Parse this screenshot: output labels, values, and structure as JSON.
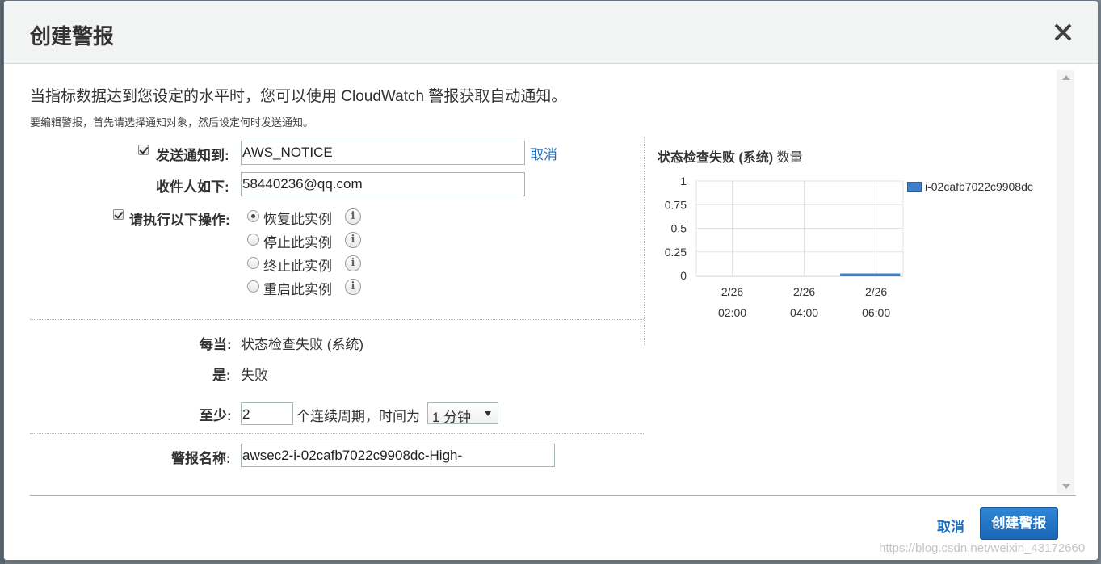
{
  "dialog": {
    "title": "创建警报",
    "intro_line1": "当指标数据达到您设定的水平时，您可以使用 CloudWatch 警报获取自动通知。",
    "intro_line2": "要编辑警报，首先请选择通知对象，然后设定何时发送通知。"
  },
  "form": {
    "send_notification": {
      "checked": true,
      "label": "发送通知到:",
      "value": "AWS_NOTICE",
      "cancel_link": "取消"
    },
    "recipients": {
      "label": "收件人如下:",
      "value": "58440236@qq.com"
    },
    "actions": {
      "checked": true,
      "label": "请执行以下操作:",
      "options": [
        {
          "label": "恢复此实例",
          "selected": true,
          "info_icon": "info-icon"
        },
        {
          "label": "停止此实例",
          "selected": false,
          "info_icon": "info-icon"
        },
        {
          "label": "终止此实例",
          "selected": false,
          "info_icon": "info-icon"
        },
        {
          "label": "重启此实例",
          "selected": false,
          "info_icon": "info-icon"
        }
      ]
    },
    "whenever": {
      "label": "每当:",
      "value": "状态检查失败 (系统)"
    },
    "is": {
      "label": "是:",
      "value": "失败"
    },
    "at_least": {
      "label": "至少:",
      "value": "2",
      "periods_text": "个连续周期，时间为",
      "period_select": "1 分钟"
    },
    "alarm_name": {
      "label": "警报名称:",
      "value": "awsec2-i-02cafb7022c9908dc-High-"
    }
  },
  "chart": {
    "title_bold": "状态检查失败 (系统)",
    "title_rest": " 数量"
  },
  "chart_data": {
    "type": "line",
    "title": "状态检查失败 (系统) 数量",
    "xlabel": "",
    "ylabel": "",
    "ylim": [
      0,
      1
    ],
    "yticks": [
      "1",
      "0.75",
      "0.5",
      "0.25",
      "0"
    ],
    "xticks": [
      {
        "date": "2/26",
        "time": "02:00"
      },
      {
        "date": "2/26",
        "time": "04:00"
      },
      {
        "date": "2/26",
        "time": "06:00"
      }
    ],
    "grid": true,
    "legend_placement": "right",
    "series": [
      {
        "name": "i-02cafb7022c9908dc",
        "color": "#3f7fc9",
        "x": [
          "05:00",
          "06:40"
        ],
        "values": [
          0,
          0
        ]
      }
    ]
  },
  "footer": {
    "cancel_label": "取消",
    "create_label": "创建警报",
    "watermark": "https://blog.csdn.net/weixin_43172660"
  },
  "colors": {
    "primary_button": "#1f6fbf",
    "link": "#1f6fbf",
    "series": "#3f7fc9",
    "header_bg": "#f2f3f3"
  }
}
